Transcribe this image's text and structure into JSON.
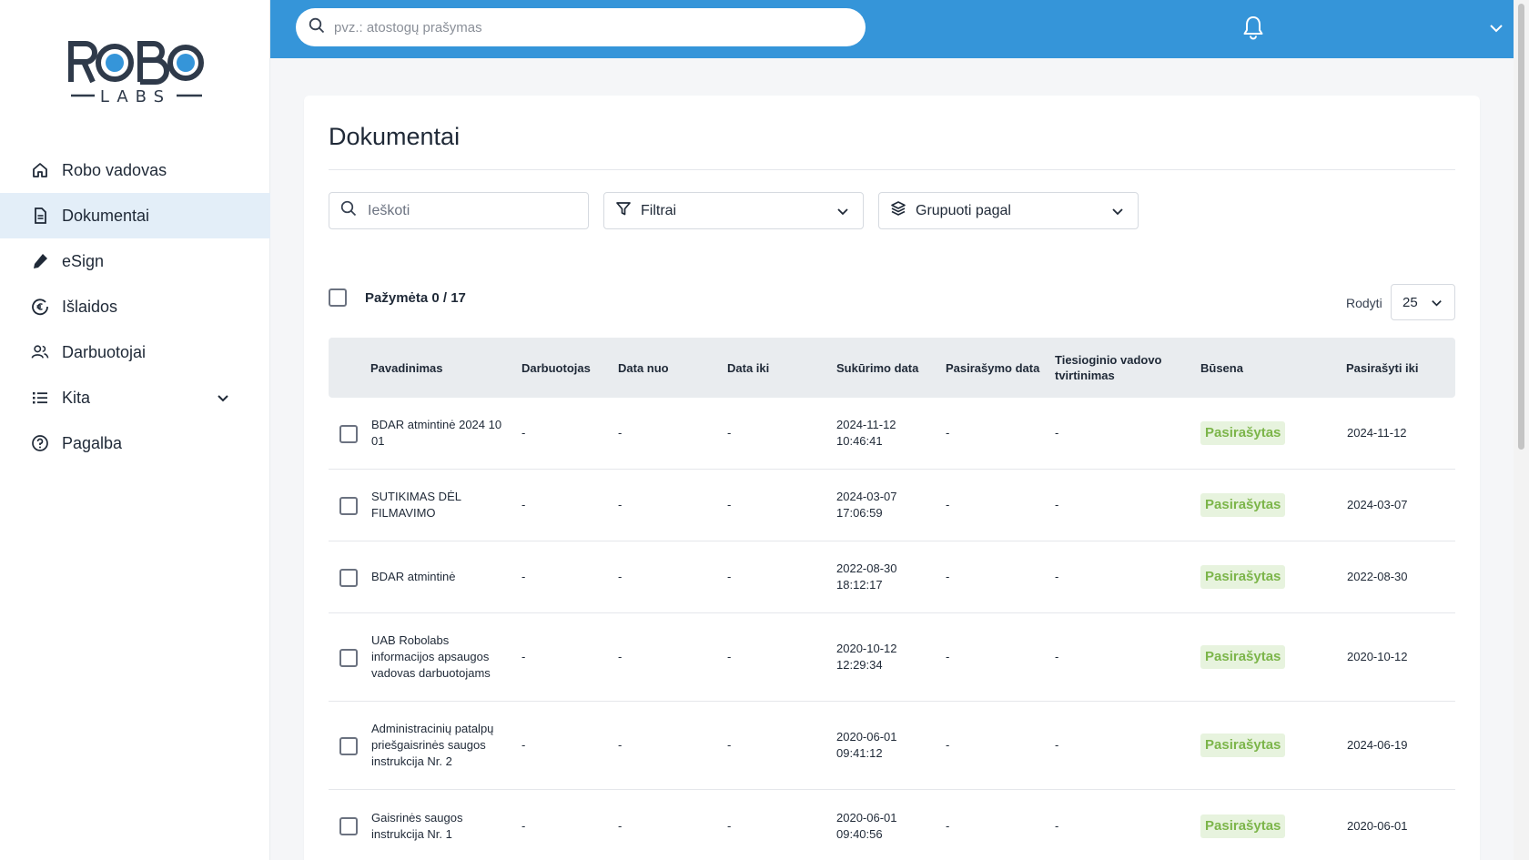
{
  "brand": {
    "logo_top": "ROBO",
    "logo_bottom": "LABS"
  },
  "sidebar": {
    "items": [
      {
        "label": "Robo vadovas",
        "icon": "home-icon"
      },
      {
        "label": "Dokumentai",
        "icon": "document-icon",
        "active": true
      },
      {
        "label": "eSign",
        "icon": "pen-icon"
      },
      {
        "label": "Išlaidos",
        "icon": "expense-icon"
      },
      {
        "label": "Darbuotojai",
        "icon": "users-icon"
      },
      {
        "label": "Kita",
        "icon": "list-icon",
        "expandable": true
      },
      {
        "label": "Pagalba",
        "icon": "help-icon"
      }
    ]
  },
  "topbar": {
    "search_placeholder": "pvz.: atostogų prašymas",
    "color": "#3595d9"
  },
  "page": {
    "title": "Dokumentai",
    "search_placeholder": "Ieškoti",
    "filter_label": "Filtrai",
    "group_label": "Grupuoti pagal",
    "selected_label": "Pažymėta 0 / 17",
    "show_label": "Rodyti",
    "page_size": "25"
  },
  "table": {
    "columns": [
      "Pavadinimas",
      "Darbuotojas",
      "Data nuo",
      "Data iki",
      "Sukūrimo data",
      "Pasirašymo data",
      "Tiesioginio vadovo tvirtinimas",
      "Būsena",
      "Pasirašyti iki"
    ],
    "rows": [
      {
        "name": "BDAR atmintinė 2024 10 01",
        "employee": "-",
        "from": "-",
        "to": "-",
        "created": "2024-11-12 10:46:41",
        "signed": "-",
        "approval": "-",
        "status": "Pasirašytas",
        "sign_by": "2024-11-12"
      },
      {
        "name": "SUTIKIMAS DĖL FILMAVIMO",
        "employee": "-",
        "from": "-",
        "to": "-",
        "created": "2024-03-07 17:06:59",
        "signed": "-",
        "approval": "-",
        "status": "Pasirašytas",
        "sign_by": "2024-03-07"
      },
      {
        "name": "BDAR atmintinė",
        "employee": "-",
        "from": "-",
        "to": "-",
        "created": "2022-08-30 18:12:17",
        "signed": "-",
        "approval": "-",
        "status": "Pasirašytas",
        "sign_by": "2022-08-30"
      },
      {
        "name": "UAB Robolabs informacijos apsaugos vadovas darbuotojams",
        "employee": "-",
        "from": "-",
        "to": "-",
        "created": "2020-10-12 12:29:34",
        "signed": "-",
        "approval": "-",
        "status": "Pasirašytas",
        "sign_by": "2020-10-12"
      },
      {
        "name": "Administracinių patalpų priešgaisrinės saugos instrukcija Nr. 2",
        "employee": "-",
        "from": "-",
        "to": "-",
        "created": "2020-06-01 09:41:12",
        "signed": "-",
        "approval": "-",
        "status": "Pasirašytas",
        "sign_by": "2024-06-19"
      },
      {
        "name": "Gaisrinės saugos instrukcija Nr. 1",
        "employee": "-",
        "from": "-",
        "to": "-",
        "created": "2020-06-01 09:40:56",
        "signed": "-",
        "approval": "-",
        "status": "Pasirašytas",
        "sign_by": "2020-06-01"
      }
    ]
  },
  "colors": {
    "accent": "#3595d9",
    "active_nav": "#e3eef8",
    "status_bg": "#e7f3de",
    "status_text": "#7cb54a",
    "logo": "#2f3a4a",
    "logo_dot": "#3595d9"
  }
}
